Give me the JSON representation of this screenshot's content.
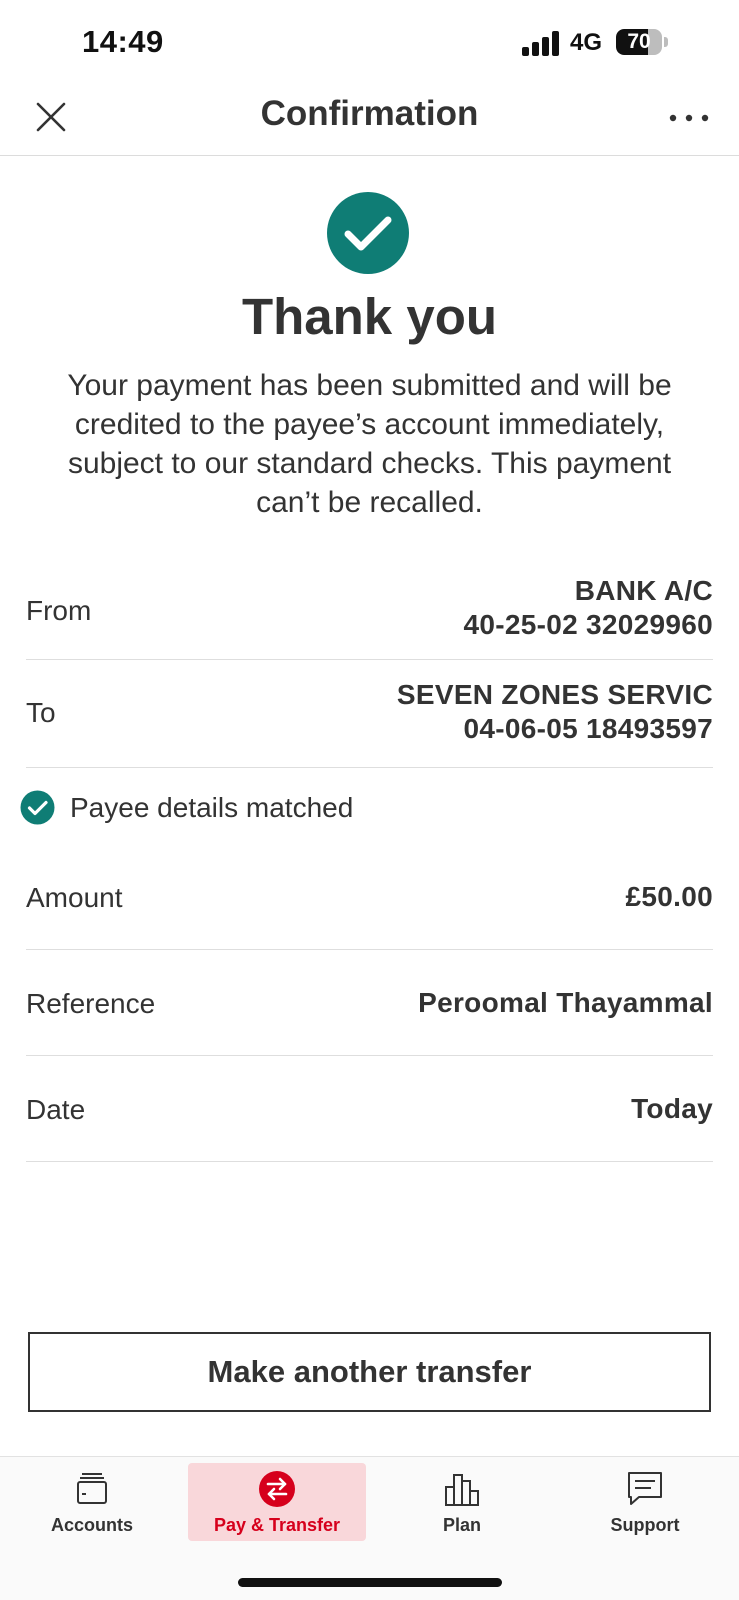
{
  "status_bar": {
    "time": "14:49",
    "network": "4G",
    "battery_level": "70",
    "battery_fraction": 0.7
  },
  "header": {
    "title": "Confirmation",
    "close_icon": "close-icon",
    "more_icon": "more-icon"
  },
  "success": {
    "icon": "check-circle-icon",
    "title": "Thank you",
    "message": "Your payment has been submitted and will be credited to the payee’s account immediately, subject to our standard checks. This payment can’t be recalled."
  },
  "details": {
    "from": {
      "label": "From",
      "line1": "BANK A/C",
      "line2": "40-25-02 32029960"
    },
    "to": {
      "label": "To",
      "line1": "SEVEN ZONES SERVIC",
      "line2": "04-06-05 18493597"
    },
    "payee_match": {
      "icon": "check-circle-icon",
      "text": "Payee details matched"
    },
    "amount": {
      "label": "Amount",
      "value": "£50.00"
    },
    "reference": {
      "label": "Reference",
      "value": "Peroomal Thayammal"
    },
    "date": {
      "label": "Date",
      "value": "Today"
    }
  },
  "cta": {
    "label": "Make another transfer"
  },
  "bottom_nav": {
    "items": [
      {
        "label": "Accounts",
        "icon": "wallet-icon",
        "active": false
      },
      {
        "label": "Pay & Transfer",
        "icon": "transfer-icon",
        "active": true
      },
      {
        "label": "Plan",
        "icon": "bar-chart-icon",
        "active": false
      },
      {
        "label": "Support",
        "icon": "chat-icon",
        "active": false
      }
    ]
  },
  "colors": {
    "success_teal": "#0f7d75",
    "brand_red": "#d6001c",
    "active_nav_bg": "#f9d7da",
    "text": "#333333"
  }
}
